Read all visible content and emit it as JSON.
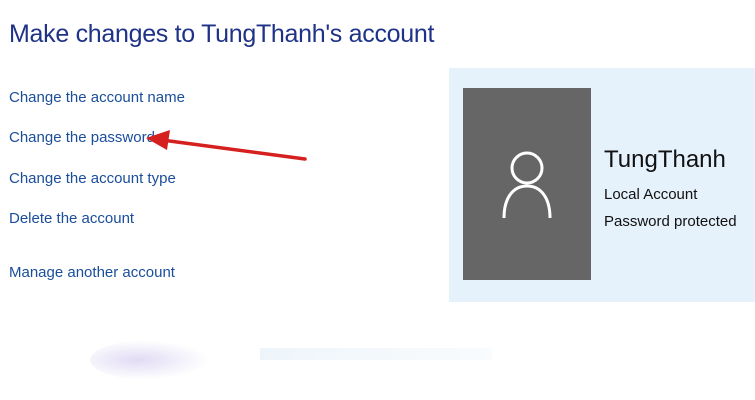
{
  "title": "Make changes to TungThanh's account",
  "links": {
    "change_name": "Change the account name",
    "change_password": "Change the password",
    "change_type": "Change the account type",
    "delete_account": "Delete the account",
    "manage_another": "Manage another account"
  },
  "account": {
    "name": "TungThanh",
    "type": "Local Account",
    "status": "Password protected",
    "avatar_icon": "user-silhouette-icon"
  },
  "colors": {
    "title": "#1e3287",
    "link": "#1a4d9c",
    "panel_background": "#e5f1fb",
    "avatar_background": "#666666",
    "annotation_arrow": "#d62020"
  }
}
